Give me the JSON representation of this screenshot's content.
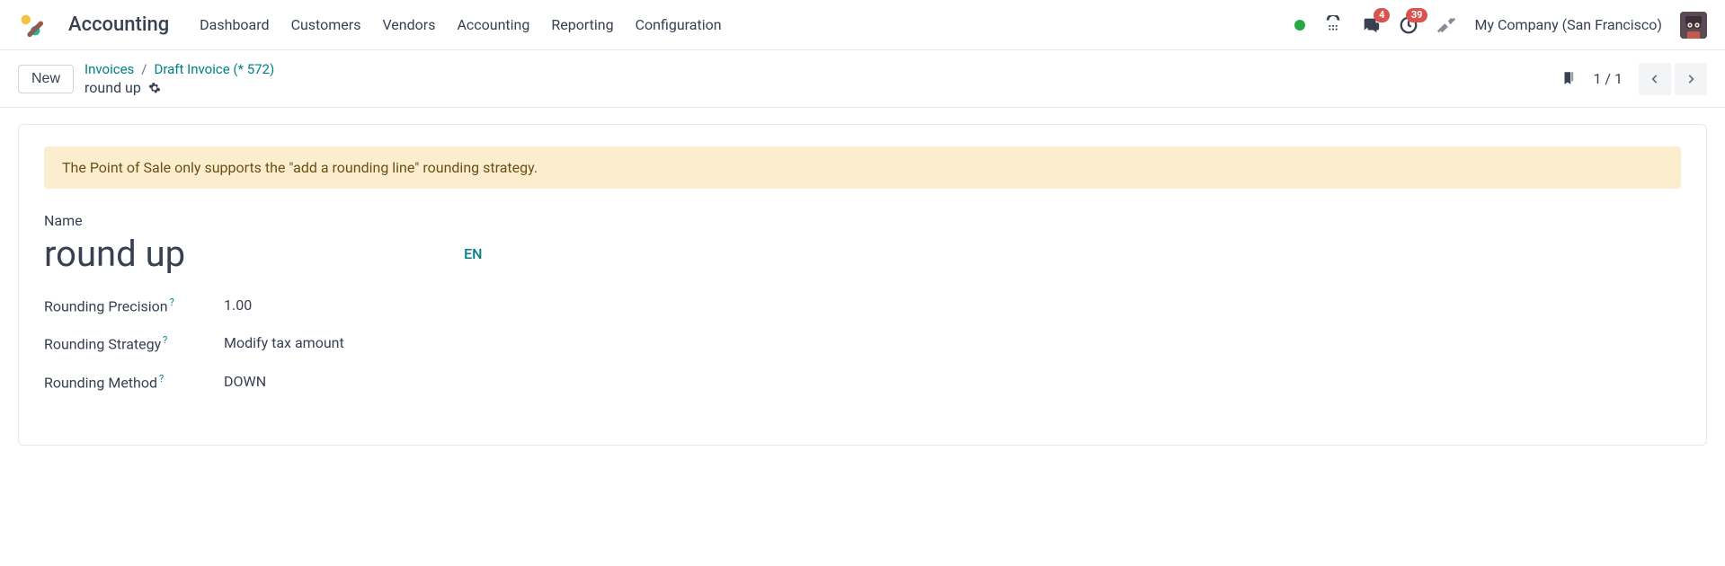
{
  "app": {
    "title": "Accounting"
  },
  "nav": {
    "dashboard": "Dashboard",
    "customers": "Customers",
    "vendors": "Vendors",
    "accounting": "Accounting",
    "reporting": "Reporting",
    "configuration": "Configuration"
  },
  "systray": {
    "messages_badge": "4",
    "activities_badge": "39",
    "company": "My Company (San Francisco)"
  },
  "subbar": {
    "new_label": "New",
    "crumb1": "Invoices",
    "crumb2": "Draft Invoice (* 572)",
    "title": "round up",
    "pager": "1 / 1"
  },
  "alert": {
    "text": "The Point of Sale only supports the \"add a rounding line\" rounding strategy."
  },
  "form": {
    "name_label": "Name",
    "name_value": "round up",
    "lang_badge": "EN",
    "precision_label": "Rounding Precision",
    "precision_value": "1.00",
    "strategy_label": "Rounding Strategy",
    "strategy_value": "Modify tax amount",
    "method_label": "Rounding Method",
    "method_value": "DOWN",
    "help": "?"
  }
}
